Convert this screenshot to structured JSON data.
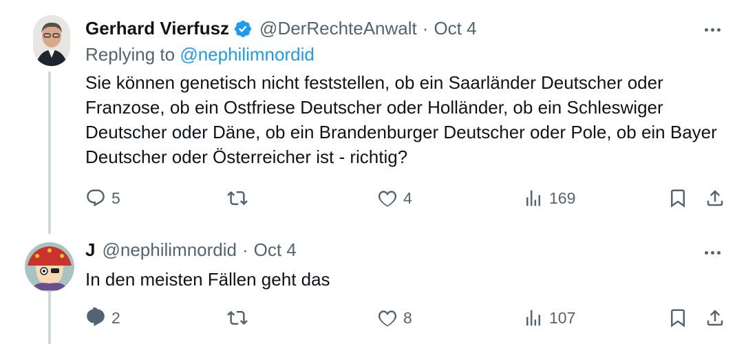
{
  "tweets": [
    {
      "name": "Gerhard Vierfusz",
      "handle": "@DerRechteAnwalt",
      "separator": "·",
      "time": "Oct 4",
      "replying_prefix": "Replying to ",
      "replying_to": "@nephilimnordid",
      "text": "Sie können genetisch nicht feststellen, ob ein Saarländer Deutscher oder Franzose, ob ein Ostfriese Deutscher oder Holländer, ob ein Schleswiger Deutscher oder Däne, ob ein Brandenburger Deutscher oder Pole, ob ein Bayer Deutscher oder Österreicher ist - richtig?",
      "replies": "5",
      "likes": "4",
      "views": "169",
      "verified": true,
      "verified_color": "#1d9bf0"
    },
    {
      "name": "J",
      "handle": "@nephilimnordid",
      "separator": "·",
      "time": "Oct 4",
      "text": "In den meisten Fällen geht das",
      "replies": "2",
      "likes": "8",
      "views": "107"
    }
  ],
  "icons": [
    "more-icon",
    "reply-icon",
    "retweet-icon",
    "like-icon",
    "views-icon",
    "bookmark-icon",
    "share-icon",
    "verified-badge-icon"
  ],
  "colors": {
    "text": "#0f1419",
    "secondary": "#536471",
    "accent": "#1d9bf0",
    "thread_line": "#cfd9de"
  }
}
